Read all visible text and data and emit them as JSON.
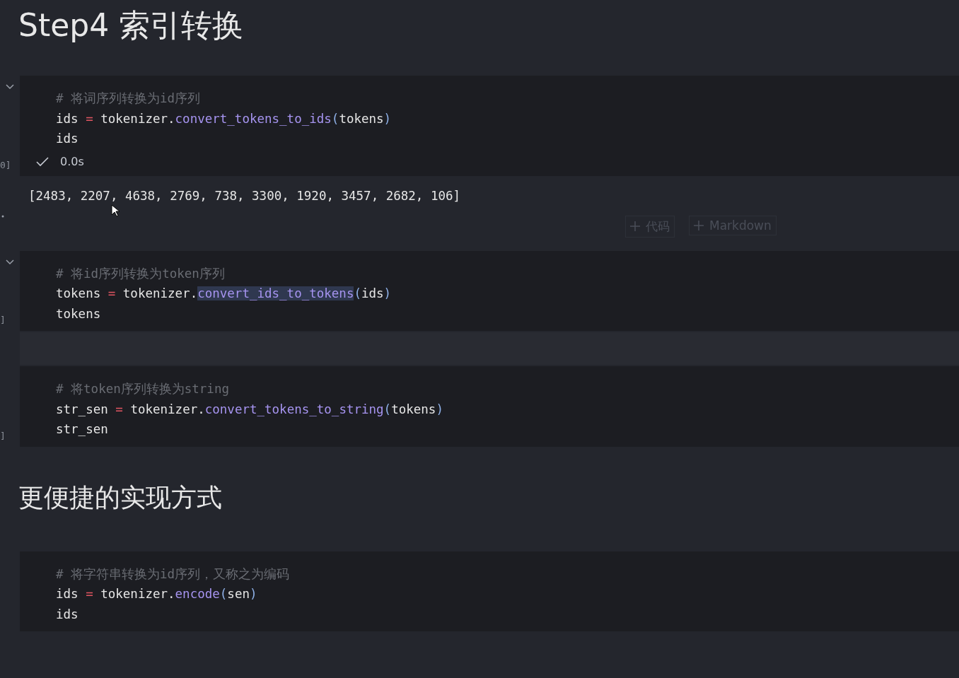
{
  "title": "Step4 索引转换",
  "cells": [
    {
      "kind": "code",
      "collapse": true,
      "exec_label": "0]",
      "lines": [
        [
          {
            "kind": "comment",
            "text": "# 将词序列转换为id序列"
          }
        ],
        [
          {
            "kind": "name",
            "text": "ids"
          },
          {
            "kind": "op",
            "text": " = "
          },
          {
            "kind": "name",
            "text": "tokenizer."
          },
          {
            "kind": "func",
            "text": "convert_tokens_to_ids",
            "highlighted": false
          },
          {
            "kind": "paren",
            "text": "("
          },
          {
            "kind": "name",
            "text": "tokens"
          },
          {
            "kind": "paren",
            "text": ")"
          }
        ],
        [
          {
            "kind": "name",
            "text": "ids"
          }
        ]
      ],
      "status": {
        "success": true,
        "time": "0.0s"
      },
      "output": "[2483, 2207, 4638, 2769, 738, 3300, 1920, 3457, 2682, 106]"
    },
    {
      "kind": "add_buttons",
      "buttons": [
        "代码",
        "Markdown"
      ]
    },
    {
      "kind": "code",
      "collapse": true,
      "exec_label": "]",
      "lines": [
        [
          {
            "kind": "comment",
            "text": "# 将id序列转换为token序列"
          }
        ],
        [
          {
            "kind": "name",
            "text": "tokens"
          },
          {
            "kind": "op",
            "text": " = "
          },
          {
            "kind": "name",
            "text": "tokenizer."
          },
          {
            "kind": "func",
            "text": "convert_ids_to_tokens",
            "highlighted": true
          },
          {
            "kind": "paren",
            "text": "("
          },
          {
            "kind": "name",
            "text": "ids"
          },
          {
            "kind": "paren",
            "text": ")"
          }
        ],
        [
          {
            "kind": "name",
            "text": "tokens"
          }
        ]
      ]
    },
    {
      "kind": "spacer"
    },
    {
      "kind": "code",
      "collapse": false,
      "exec_label": "]",
      "lines": [
        [
          {
            "kind": "comment",
            "text": "# 将token序列转换为string"
          }
        ],
        [
          {
            "kind": "name",
            "text": "str_sen"
          },
          {
            "kind": "op",
            "text": " = "
          },
          {
            "kind": "name",
            "text": "tokenizer."
          },
          {
            "kind": "func",
            "text": "convert_tokens_to_string",
            "highlighted": false
          },
          {
            "kind": "paren",
            "text": "("
          },
          {
            "kind": "name",
            "text": "tokens"
          },
          {
            "kind": "paren",
            "text": ")"
          }
        ],
        [
          {
            "kind": "name",
            "text": "str_sen"
          }
        ]
      ]
    },
    {
      "kind": "heading",
      "text": "更便捷的实现方式"
    },
    {
      "kind": "code",
      "collapse": false,
      "lines": [
        [
          {
            "kind": "comment",
            "text": "# 将字符串转换为id序列，又称之为编码"
          }
        ],
        [
          {
            "kind": "name",
            "text": "ids"
          },
          {
            "kind": "op",
            "text": " = "
          },
          {
            "kind": "name",
            "text": "tokenizer."
          },
          {
            "kind": "func",
            "text": "encode",
            "highlighted": false
          },
          {
            "kind": "paren",
            "text": "("
          },
          {
            "kind": "name",
            "text": "sen"
          },
          {
            "kind": "paren",
            "text": ")"
          }
        ],
        [
          {
            "kind": "name",
            "text": "ids"
          }
        ]
      ]
    }
  ]
}
